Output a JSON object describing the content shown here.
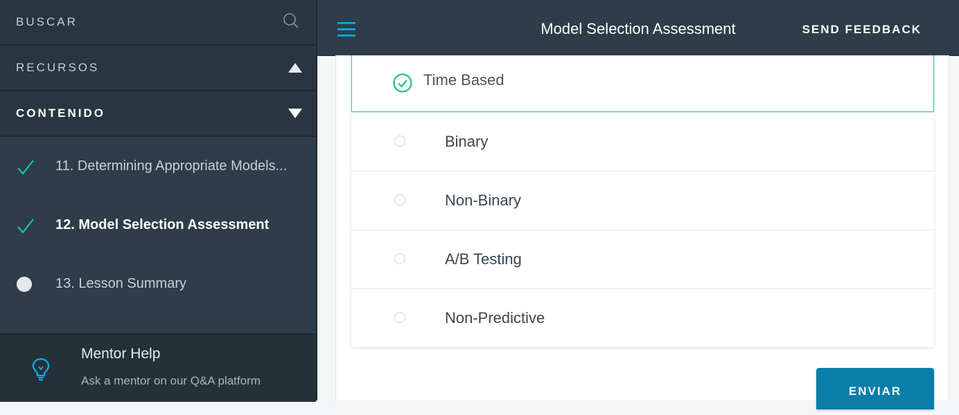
{
  "sidebar": {
    "search_label": "BUSCAR",
    "recursos_label": "RECURSOS",
    "contenido_label": "CONTENIDO",
    "lessons": [
      {
        "label": "11. Determining Appropriate Models...",
        "state": "completed"
      },
      {
        "label": "12. Model Selection Assessment",
        "state": "completed-active"
      },
      {
        "label": "13. Lesson Summary",
        "state": "not-started"
      }
    ],
    "mentor": {
      "title": "Mentor Help",
      "subtitle": "Ask a mentor on our Q&A platform"
    }
  },
  "header": {
    "title": "Model Selection Assessment",
    "feedback_label": "SEND FEEDBACK"
  },
  "quiz": {
    "options": [
      {
        "label": "Time Based",
        "selected": true
      },
      {
        "label": "Binary",
        "selected": false
      },
      {
        "label": "Non-Binary",
        "selected": false
      },
      {
        "label": "A/B Testing",
        "selected": false
      },
      {
        "label": "Non-Predictive",
        "selected": false
      }
    ],
    "submit_label": "ENVIAR"
  },
  "colors": {
    "accent": "#02b3e4",
    "check_green": "#3cc68a",
    "teal_check": "#19c0b7",
    "button_blue": "#0a7ea8",
    "sidebar_bg": "#2e3d49"
  }
}
